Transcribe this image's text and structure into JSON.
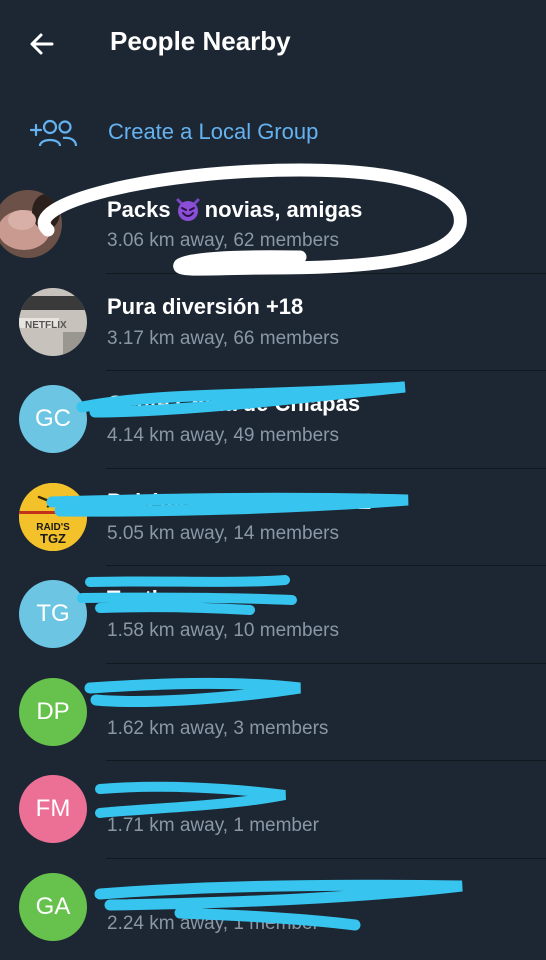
{
  "header": {
    "title": "People Nearby",
    "back_icon": "arrow-left-icon"
  },
  "create_group": {
    "label": "Create a Local Group",
    "icon": "add-group-icon",
    "color": "#64b2f0"
  },
  "groups": [
    {
      "name_before": "Packs",
      "name_after": "novias, amigas",
      "emoji": "smiling-devil",
      "subtitle": "3.06 km away, 62 members",
      "avatar": "photo"
    },
    {
      "name": "Pura diversión +18",
      "subtitle": "3.17 km away, 66 members",
      "avatar": "photo"
    },
    {
      "name": "Gente Chida de Chiapas",
      "initials": "GC",
      "avatar_color": "#6bc5e3",
      "subtitle": "4.14 km away, 49 members"
    },
    {
      "name": "Pokémon GO RAIDS TGZ",
      "avatar_text": [
        "RAID'S",
        "TGZ"
      ],
      "avatar_color": "#f3c12a",
      "subtitle": "5.05 km away, 14 members"
    },
    {
      "name": "Tuxtla",
      "initials": "TG",
      "avatar_color": "#6bc5e3",
      "subtitle": "1.58 km away, 10 members"
    },
    {
      "name": "",
      "initials": "DP",
      "avatar_color": "#66c24c",
      "subtitle": "1.62 km away, 3 members"
    },
    {
      "name": "",
      "initials": "FM",
      "avatar_color": "#ec6f96",
      "subtitle": "1.71 km away, 1 member"
    },
    {
      "name": "",
      "initials": "GA",
      "avatar_color": "#66c24c",
      "subtitle": "2.24 km away, 1 member"
    }
  ]
}
